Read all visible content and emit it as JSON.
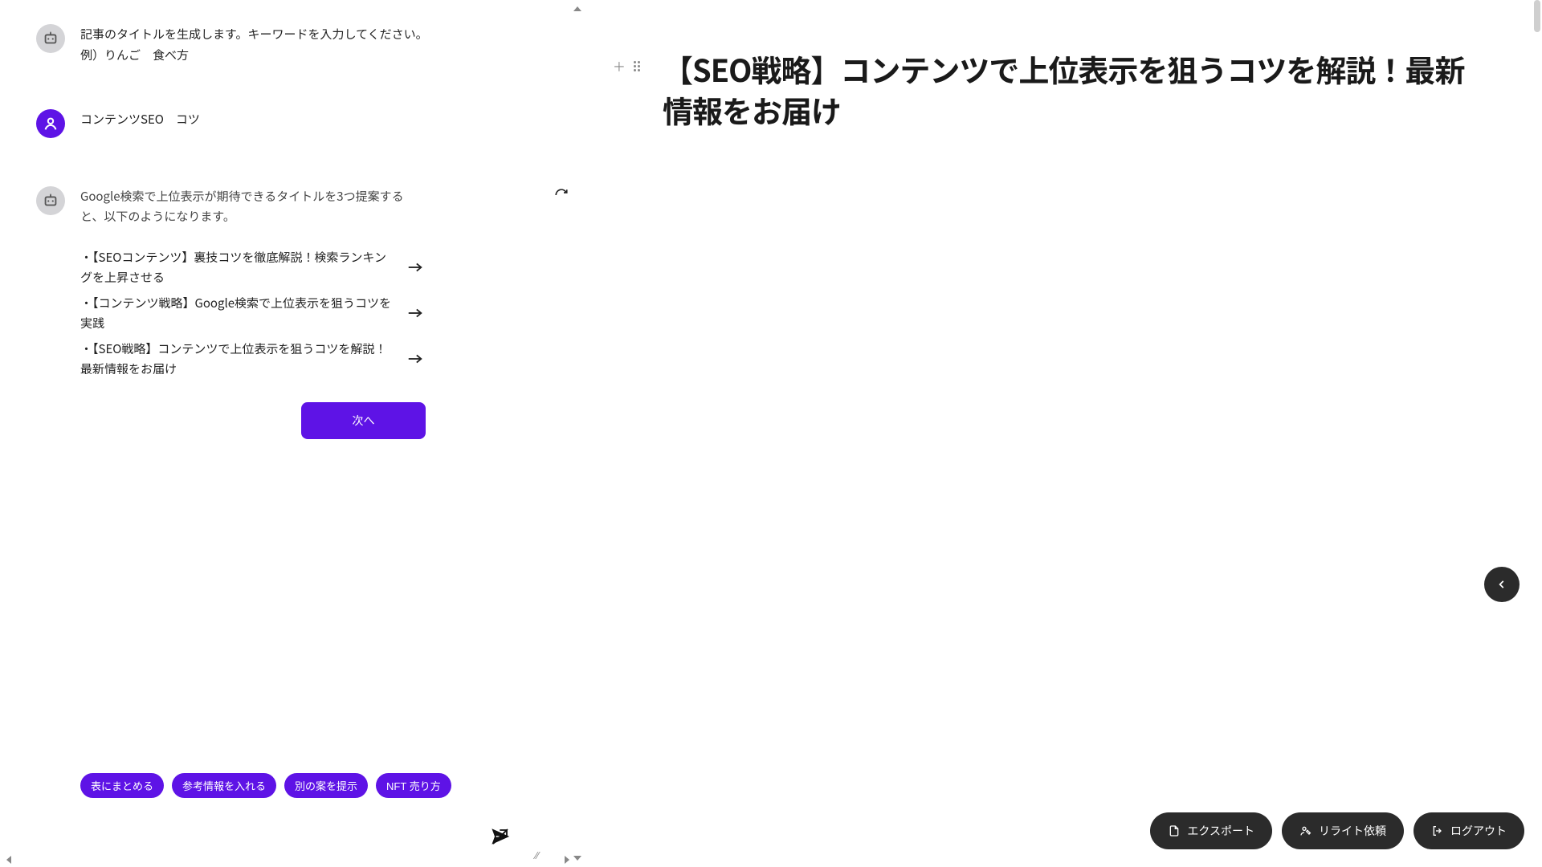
{
  "chat": {
    "bot1_line1": "記事のタイトルを生成します。キーワードを入力してください。",
    "bot1_line2": "例）りんご　食べ方",
    "user1": "コンテンツSEO　コツ",
    "bot2_intro": "Google検索で上位表示が期待できるタイトルを3つ提案すると、以下のようになります。",
    "suggestions": [
      "・【SEOコンテンツ】裏技コツを徹底解説！検索ランキングを上昇させる",
      "・【コンテンツ戦略】Google検索で上位表示を狙うコツを実践",
      "・【SEO戦略】コンテンツで上位表示を狙うコツを解説！最新情報をお届け"
    ],
    "next_label": "次へ"
  },
  "chips": [
    "表にまとめる",
    "参考情報を入れる",
    "別の案を提示",
    "NFT 売り方"
  ],
  "composer": {
    "placeholder": ""
  },
  "doc": {
    "title": "【SEO戦略】コンテンツで上位表示を狙うコツを解説！最新情報をお届け"
  },
  "actions": {
    "export": "エクスポート",
    "rewrite": "リライト依頼",
    "logout": "ログアウト"
  }
}
